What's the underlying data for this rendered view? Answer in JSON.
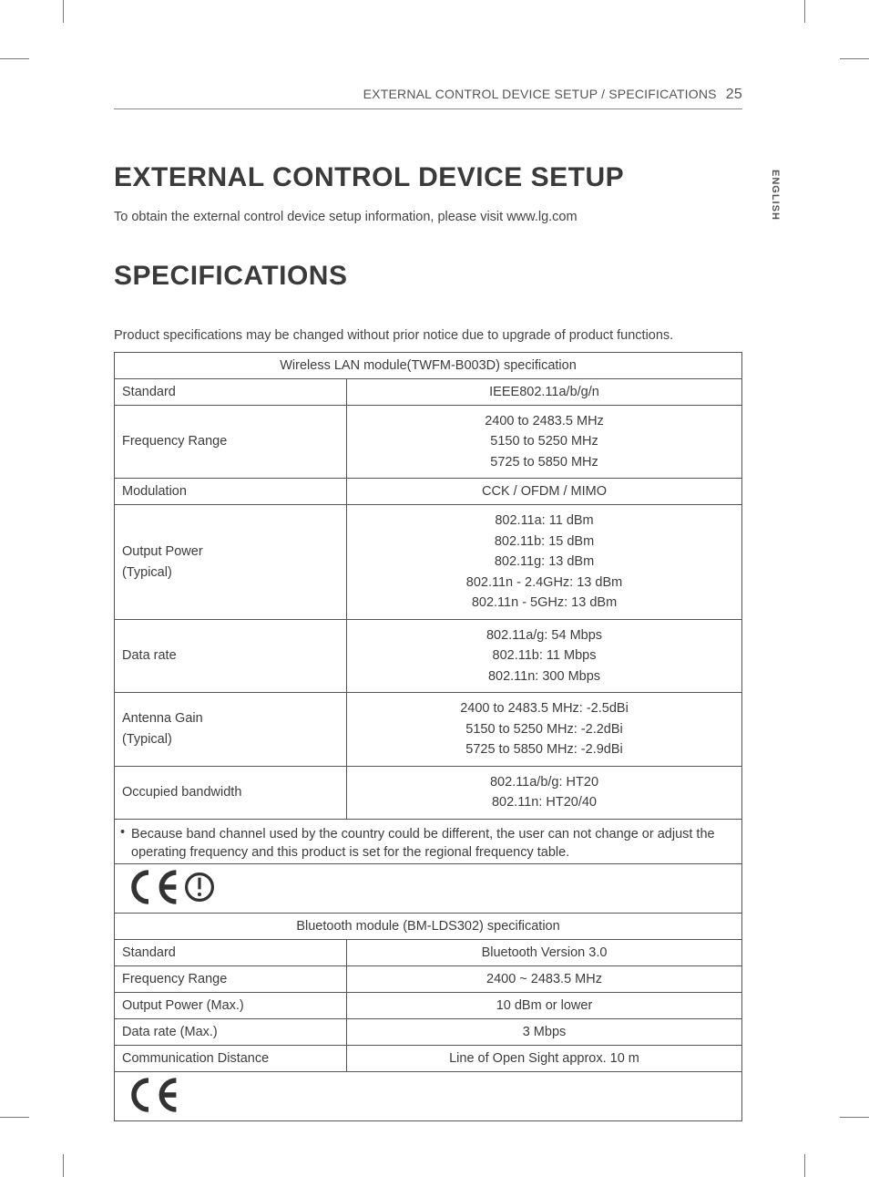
{
  "header": {
    "section": "EXTERNAL CONTROL DEVICE SETUP / SPECIFICATIONS",
    "page": "25"
  },
  "lang_tab": "ENGLISH",
  "h1_a": "EXTERNAL CONTROL DEVICE SETUP",
  "intro_a": "To obtain the external control device setup information, please visit www.lg.com",
  "h1_b": "SPECIFICATIONS",
  "intro_b": "Product specifications may be changed without prior notice due to upgrade of product functions.",
  "wlan": {
    "title": "Wireless LAN module(TWFM-B003D) specification",
    "rows": {
      "standard": {
        "label": "Standard",
        "value": "IEEE802.11a/b/g/n"
      },
      "freq": {
        "label": "Frequency Range",
        "lines": [
          "2400 to 2483.5 MHz",
          "5150 to 5250 MHz",
          "5725 to 5850 MHz"
        ]
      },
      "modulation": {
        "label": "Modulation",
        "value": "CCK / OFDM / MIMO"
      },
      "power": {
        "label": "Output Power\n(Typical)",
        "lines": [
          "802.11a: 11 dBm",
          "802.11b: 15 dBm",
          "802.11g: 13 dBm",
          "802.11n - 2.4GHz: 13 dBm",
          "802.11n - 5GHz: 13 dBm"
        ]
      },
      "rate": {
        "label": "Data rate",
        "lines": [
          "802.11a/g: 54 Mbps",
          "802.11b: 11 Mbps",
          "802.11n: 300 Mbps"
        ]
      },
      "antenna": {
        "label": "Antenna Gain\n(Typical)",
        "lines": [
          "2400 to 2483.5 MHz: -2.5dBi",
          "5150 to 5250 MHz: -2.2dBi",
          "5725 to 5850 MHz: -2.9dBi"
        ]
      },
      "bandwidth": {
        "label": "Occupied bandwidth",
        "lines": [
          "802.11a/b/g: HT20",
          "802.11n: HT20/40"
        ]
      }
    },
    "note": "Because band channel used by the country could be different, the user can not change or adjust the operating frequency and this product is set for the regional frequency table.",
    "cert": "CE-alert"
  },
  "bt": {
    "title": "Bluetooth module (BM-LDS302) specification",
    "rows": {
      "standard": {
        "label": "Standard",
        "value": "Bluetooth Version 3.0"
      },
      "freq": {
        "label": "Frequency Range",
        "value": "2400 ~ 2483.5 MHz"
      },
      "power": {
        "label": "Output Power (Max.)",
        "value": "10 dBm or lower"
      },
      "rate": {
        "label": "Data rate (Max.)",
        "value": "3 Mbps"
      },
      "dist": {
        "label": "Communication Distance",
        "value": "Line of Open Sight approx. 10 m"
      }
    },
    "cert": "CE"
  }
}
